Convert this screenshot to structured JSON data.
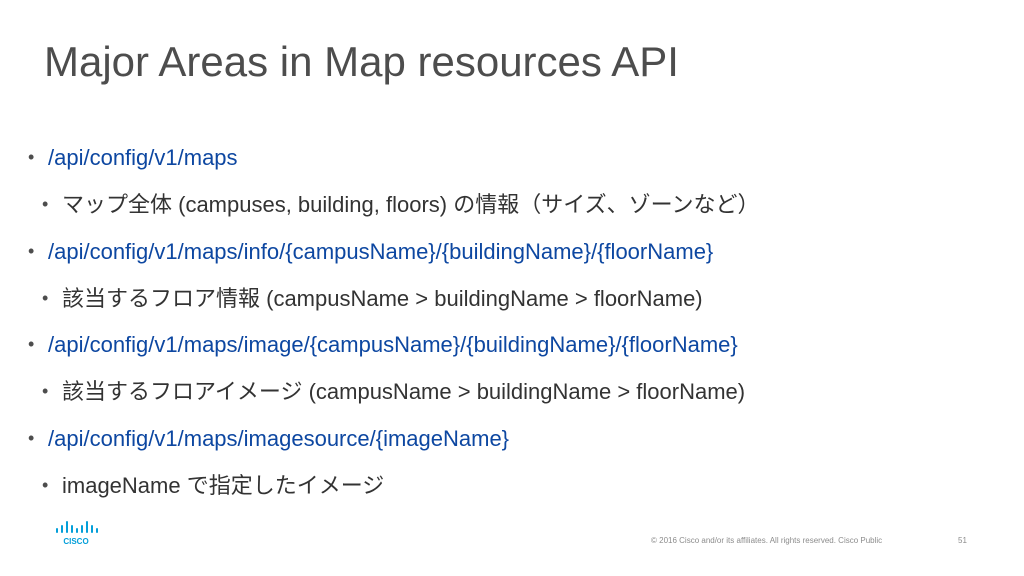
{
  "slide": {
    "title": "Major Areas in Map resources API"
  },
  "bullets": [
    {
      "level": 1,
      "text": "/api/config/v1/maps"
    },
    {
      "level": 2,
      "text": "マップ全体 (campuses, building, floors) の情報（サイズ、ゾーンなど）"
    },
    {
      "level": 1,
      "text": "/api/config/v1/maps/info/{campusName}/{buildingName}/{floorName}"
    },
    {
      "level": 2,
      "text": "該当するフロア情報 (campusName > buildingName > floorName)"
    },
    {
      "level": 1,
      "text": "/api/config/v1/maps/image/{campusName}/{buildingName}/{floorName}"
    },
    {
      "level": 2,
      "text": "該当するフロアイメージ (campusName > buildingName > floorName)"
    },
    {
      "level": 1,
      "text": "/api/config/v1/maps/imagesource/{imageName}"
    },
    {
      "level": 2,
      "text": "imageName で指定したイメージ"
    }
  ],
  "bullet_char": "•",
  "footer": {
    "logo_text": "CISCO",
    "copyright": "© 2016  Cisco and/or its affiliates. All rights reserved.   Cisco Public",
    "page_number": "51"
  },
  "colors": {
    "title": "#4d4d4d",
    "level1_text": "#0d47a1",
    "level2_text": "#333333",
    "cisco_blue": "#049fd9",
    "footer_text": "#8c8c8c"
  }
}
